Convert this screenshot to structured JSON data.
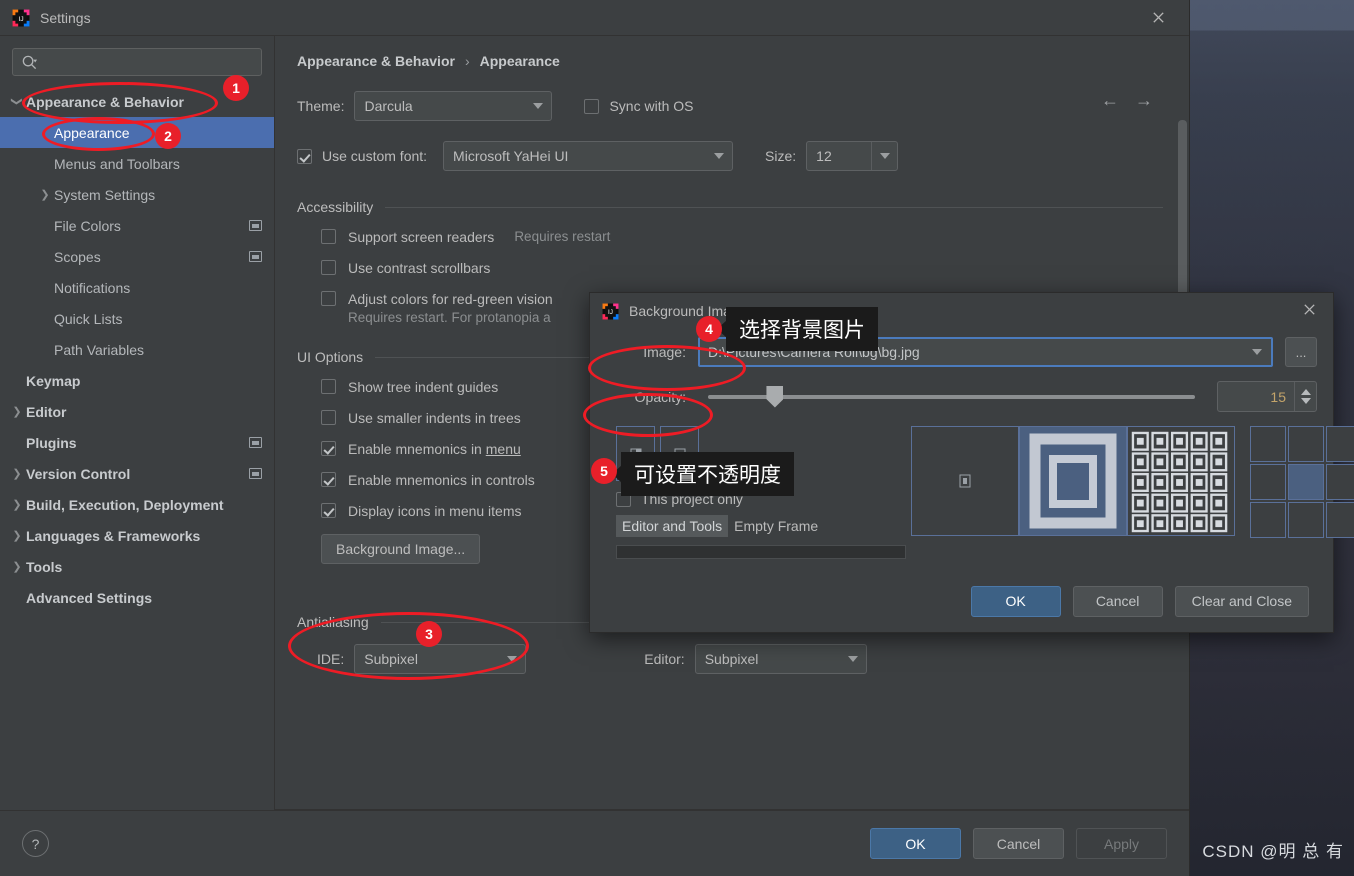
{
  "window": {
    "title": "Settings",
    "close_icon": "close-icon",
    "app_icon": "intellij-idea-icon"
  },
  "search": {
    "placeholder": "",
    "value": "",
    "icon": "search-icon"
  },
  "sidebar": {
    "items": [
      {
        "label": "Appearance & Behavior",
        "indent": 0,
        "arrow": "v",
        "bold": true,
        "selected": false,
        "badge": false
      },
      {
        "label": "Appearance",
        "indent": 1,
        "arrow": "",
        "bold": false,
        "selected": true,
        "badge": false
      },
      {
        "label": "Menus and Toolbars",
        "indent": 1,
        "arrow": "",
        "bold": false,
        "selected": false,
        "badge": false
      },
      {
        "label": "System Settings",
        "indent": 1,
        "arrow": ">",
        "bold": false,
        "selected": false,
        "badge": false
      },
      {
        "label": "File Colors",
        "indent": 1,
        "arrow": "",
        "bold": false,
        "selected": false,
        "badge": true
      },
      {
        "label": "Scopes",
        "indent": 1,
        "arrow": "",
        "bold": false,
        "selected": false,
        "badge": true
      },
      {
        "label": "Notifications",
        "indent": 1,
        "arrow": "",
        "bold": false,
        "selected": false,
        "badge": false
      },
      {
        "label": "Quick Lists",
        "indent": 1,
        "arrow": "",
        "bold": false,
        "selected": false,
        "badge": false
      },
      {
        "label": "Path Variables",
        "indent": 1,
        "arrow": "",
        "bold": false,
        "selected": false,
        "badge": false
      },
      {
        "label": "Keymap",
        "indent": 0,
        "arrow": "",
        "bold": true,
        "selected": false,
        "badge": false
      },
      {
        "label": "Editor",
        "indent": 0,
        "arrow": ">",
        "bold": true,
        "selected": false,
        "badge": false
      },
      {
        "label": "Plugins",
        "indent": 0,
        "arrow": "",
        "bold": true,
        "selected": false,
        "badge": true
      },
      {
        "label": "Version Control",
        "indent": 0,
        "arrow": ">",
        "bold": true,
        "selected": false,
        "badge": true
      },
      {
        "label": "Build, Execution, Deployment",
        "indent": 0,
        "arrow": ">",
        "bold": true,
        "selected": false,
        "badge": false
      },
      {
        "label": "Languages & Frameworks",
        "indent": 0,
        "arrow": ">",
        "bold": true,
        "selected": false,
        "badge": false
      },
      {
        "label": "Tools",
        "indent": 0,
        "arrow": ">",
        "bold": true,
        "selected": false,
        "badge": false
      },
      {
        "label": "Advanced Settings",
        "indent": 0,
        "arrow": "",
        "bold": true,
        "selected": false,
        "badge": false
      }
    ]
  },
  "main": {
    "breadcrumb": {
      "parent": "Appearance & Behavior",
      "separator": "›",
      "current": "Appearance"
    },
    "nav": {
      "back": "←",
      "forward": "→"
    },
    "theme": {
      "label": "Theme:",
      "value": "Darcula",
      "sync_label": "Sync with OS",
      "sync_checked": false
    },
    "font": {
      "use_custom_label": "Use custom font:",
      "use_custom_checked": true,
      "family": "Microsoft YaHei UI",
      "size_label": "Size:",
      "size_value": "12"
    },
    "accessibility": {
      "title": "Accessibility",
      "options": [
        {
          "label": "Support screen readers",
          "checked": false,
          "note": "Requires restart"
        },
        {
          "label": "Use contrast scrollbars",
          "checked": false,
          "note": ""
        },
        {
          "label": "Adjust colors for red-green vision",
          "checked": false,
          "note": ""
        }
      ],
      "protanopia_note": "Requires restart. For protanopia a"
    },
    "ui_options": {
      "title": "UI Options",
      "options": [
        {
          "label": "Show tree indent guides",
          "checked": false
        },
        {
          "label": "Use smaller indents in trees",
          "checked": false
        },
        {
          "label": "Enable mnemonics in menu",
          "checked": true,
          "mnemonic": "menu"
        },
        {
          "label": "Enable mnemonics in controls",
          "checked": true
        },
        {
          "label": "Display icons in menu items",
          "checked": true
        }
      ],
      "background_image_button": "Background Image..."
    },
    "antialiasing": {
      "title": "Antialiasing",
      "ide_label": "IDE:",
      "ide_value": "Subpixel",
      "editor_label": "Editor:",
      "editor_value": "Subpixel"
    }
  },
  "footer": {
    "help": "?",
    "ok": "OK",
    "cancel": "Cancel",
    "apply": "Apply"
  },
  "bg_dialog": {
    "title": "Background Image",
    "app_icon": "intellij-idea-icon",
    "close_icon": "close-icon",
    "image_label": "Image:",
    "image_path": "D:\\Pictures\\Camera Roll\\bg\\bg.jpg",
    "browse_label": "...",
    "opacity_label": "Opacity:",
    "opacity_value": "15",
    "this_project_only_label": "This project only",
    "this_project_only_checked": false,
    "tabs": [
      {
        "label": "Editor and Tools",
        "active": true
      },
      {
        "label": "Empty Frame",
        "active": false
      }
    ],
    "fill_modes": [
      "scale",
      "tile",
      "center"
    ],
    "buttons": {
      "ok": "OK",
      "cancel": "Cancel",
      "clear_and_close": "Clear and Close"
    }
  },
  "annotations": [
    {
      "num": "1",
      "tip": ""
    },
    {
      "num": "2",
      "tip": ""
    },
    {
      "num": "3",
      "tip": ""
    },
    {
      "num": "4",
      "tip": "选择背景图片"
    },
    {
      "num": "5",
      "tip": "可设置不透明度"
    }
  ],
  "watermark": "CSDN @明 总 有",
  "colors": {
    "accent": "#4b6eaf",
    "annotation_red": "#ee1c25",
    "dialog_bg": "#3c3f41",
    "field_focus": "#4b7bbd"
  }
}
